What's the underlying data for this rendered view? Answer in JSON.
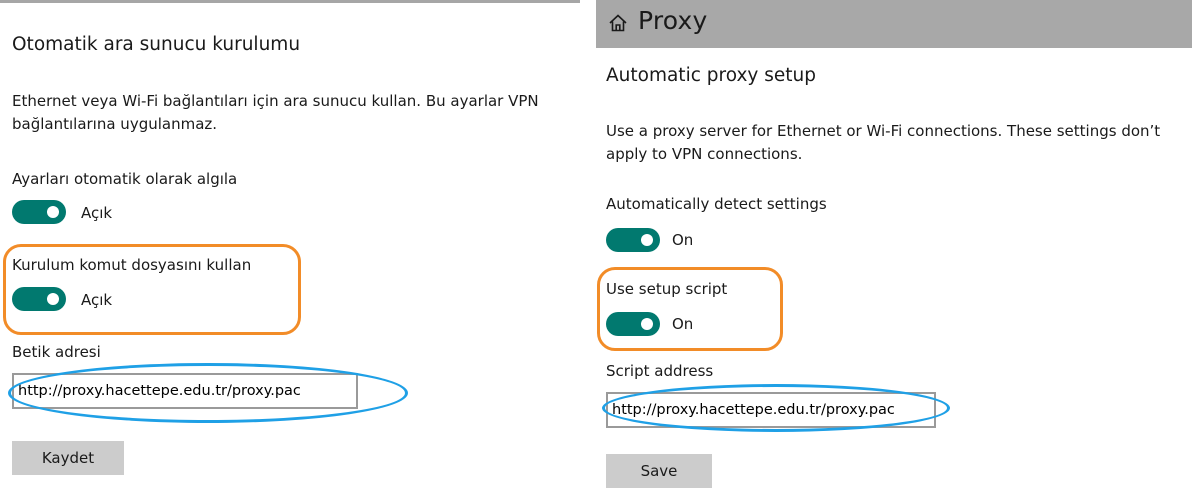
{
  "left_panel": {
    "section_title": "Otomatik ara sunucu kurulumu",
    "description": "Ethernet veya Wi-Fi bağlantıları için ara sunucu kullan. Bu ayarlar VPN bağlantılarına uygulanmaz.",
    "auto_detect": {
      "label": "Ayarları otomatik olarak algıla",
      "state": "Açık",
      "on": true
    },
    "setup_script": {
      "label": "Kurulum komut dosyasını kullan",
      "state": "Açık",
      "on": true
    },
    "script_address": {
      "label": "Betik adresi",
      "value": "http://proxy.hacettepe.edu.tr/proxy.pac"
    },
    "save_label": "Kaydet"
  },
  "right_panel": {
    "header": {
      "title": "Proxy",
      "icon": "home-icon"
    },
    "section_title": "Automatic proxy setup",
    "description": "Use a proxy server for Ethernet or Wi-Fi connections. These settings don’t apply to VPN connections.",
    "auto_detect": {
      "label": "Automatically detect settings",
      "state": "On",
      "on": true
    },
    "setup_script": {
      "label": "Use setup script",
      "state": "On",
      "on": true
    },
    "script_address": {
      "label": "Script address",
      "value": "http://proxy.hacettepe.edu.tr/proxy.pac"
    },
    "save_label": "Save"
  },
  "colors": {
    "toggle_on": "#01796f",
    "header_bg": "#a8a8a8",
    "button_bg": "#cccccc",
    "highlight_orange": "#f28c28",
    "highlight_blue": "#1fa0e6"
  }
}
